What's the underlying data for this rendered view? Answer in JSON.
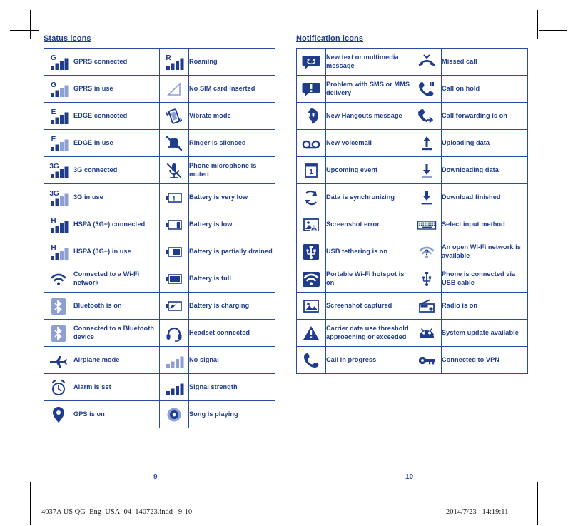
{
  "document": {
    "page_numbers": {
      "left": "9",
      "right": "10"
    },
    "footer": {
      "filename": "4037A US QG_Eng_USA_04_140723.indd   9-10",
      "timestamp": "2014/7/23   14:19:11"
    },
    "colors": {
      "ink": "#1f3d8c",
      "rule": "#2a4ca0",
      "light": "#8e9fd4",
      "paper": "#ffffff",
      "crop_mark": "#000000"
    }
  },
  "status_section": {
    "title": "Status icons",
    "rows": [
      {
        "left": {
          "icon": "signal-gprs-connected-icon",
          "label": "GPRS connected"
        },
        "right": {
          "icon": "signal-roaming-icon",
          "label": "Roaming"
        }
      },
      {
        "left": {
          "icon": "signal-gprs-in-use-icon",
          "label": "GPRS in use"
        },
        "right": {
          "icon": "no-sim-card-icon",
          "label": "No SIM card inserted"
        }
      },
      {
        "left": {
          "icon": "signal-edge-connected-icon",
          "label": "EDGE connected"
        },
        "right": {
          "icon": "vibrate-mode-icon",
          "label": "Vibrate mode"
        }
      },
      {
        "left": {
          "icon": "signal-edge-in-use-icon",
          "label": "EDGE in use"
        },
        "right": {
          "icon": "ringer-silenced-icon",
          "label": "Ringer is silenced"
        }
      },
      {
        "left": {
          "icon": "signal-3g-connected-icon",
          "label": "3G connected"
        },
        "right": {
          "icon": "microphone-muted-icon",
          "label": "Phone microphone is muted"
        }
      },
      {
        "left": {
          "icon": "signal-3g-in-use-icon",
          "label": "3G in use"
        },
        "right": {
          "icon": "battery-very-low-icon",
          "label": "Battery is very low"
        }
      },
      {
        "left": {
          "icon": "signal-hspa-connected-icon",
          "label": "HSPA (3G+) connected"
        },
        "right": {
          "icon": "battery-low-icon",
          "label": "Battery is low"
        }
      },
      {
        "left": {
          "icon": "signal-hspa-in-use-icon",
          "label": "HSPA (3G+) in use"
        },
        "right": {
          "icon": "battery-partially-drained-icon",
          "label": "Battery is partially drained"
        }
      },
      {
        "left": {
          "icon": "wifi-connected-icon",
          "label": "Connected to a Wi-Fi network"
        },
        "right": {
          "icon": "battery-full-icon",
          "label": "Battery is full"
        }
      },
      {
        "left": {
          "icon": "bluetooth-on-icon",
          "label": "Bluetooth is on"
        },
        "right": {
          "icon": "battery-charging-icon",
          "label": "Battery is charging"
        }
      },
      {
        "left": {
          "icon": "bluetooth-connected-icon",
          "label": "Connected to a Bluetooth device"
        },
        "right": {
          "icon": "headset-connected-icon",
          "label": "Headset connected"
        }
      },
      {
        "left": {
          "icon": "airplane-mode-icon",
          "label": "Airplane mode"
        },
        "right": {
          "icon": "no-signal-icon",
          "label": "No signal"
        }
      },
      {
        "left": {
          "icon": "alarm-set-icon",
          "label": "Alarm is set"
        },
        "right": {
          "icon": "signal-strength-icon",
          "label": "Signal strength"
        }
      },
      {
        "left": {
          "icon": "gps-on-icon",
          "label": "GPS is on"
        },
        "right": {
          "icon": "song-playing-icon",
          "label": "Song is playing"
        }
      }
    ]
  },
  "notification_section": {
    "title": "Notification icons",
    "rows": [
      {
        "left": {
          "icon": "new-message-icon",
          "label": "New text or multimedia message"
        },
        "right": {
          "icon": "missed-call-icon",
          "label": "Missed call"
        }
      },
      {
        "left": {
          "icon": "message-problem-icon",
          "label": "Problem with SMS or MMS delivery"
        },
        "right": {
          "icon": "call-on-hold-icon",
          "label": "Call on hold"
        }
      },
      {
        "left": {
          "icon": "hangouts-message-icon",
          "label": "New Hangouts message"
        },
        "right": {
          "icon": "call-forwarding-icon",
          "label": "Call forwarding is on"
        }
      },
      {
        "left": {
          "icon": "voicemail-icon",
          "label": "New voicemail"
        },
        "right": {
          "icon": "upload-data-icon",
          "label": "Uploading data"
        }
      },
      {
        "left": {
          "icon": "upcoming-event-icon",
          "label": "Upcoming event"
        },
        "right": {
          "icon": "download-data-icon",
          "label": "Downloading data"
        }
      },
      {
        "left": {
          "icon": "sync-icon",
          "label": "Data is synchronizing"
        },
        "right": {
          "icon": "download-finished-icon",
          "label": "Download finished"
        }
      },
      {
        "left": {
          "icon": "screenshot-error-icon",
          "label": "Screenshot error"
        },
        "right": {
          "icon": "keyboard-icon",
          "label": "Select input method"
        }
      },
      {
        "left": {
          "icon": "usb-tethering-icon",
          "label": "USB tethering is on"
        },
        "right": {
          "icon": "open-wifi-network-icon",
          "label": "An open Wi-Fi network is available"
        }
      },
      {
        "left": {
          "icon": "wifi-hotspot-icon",
          "label": "Portable Wi-Fi hotspot is on"
        },
        "right": {
          "icon": "usb-connected-icon",
          "label": "Phone is connected via USB cable"
        }
      },
      {
        "left": {
          "icon": "screenshot-captured-icon",
          "label": "Screenshot captured"
        },
        "right": {
          "icon": "radio-on-icon",
          "label": "Radio is on"
        }
      },
      {
        "left": {
          "icon": "data-warning-icon",
          "label": "Carrier data use threshold approaching or exceeded"
        },
        "right": {
          "icon": "system-update-icon",
          "label": "System update available"
        }
      },
      {
        "left": {
          "icon": "call-in-progress-icon",
          "label": "Call in progress"
        },
        "right": {
          "icon": "vpn-connected-icon",
          "label": "Connected to VPN"
        }
      }
    ]
  }
}
